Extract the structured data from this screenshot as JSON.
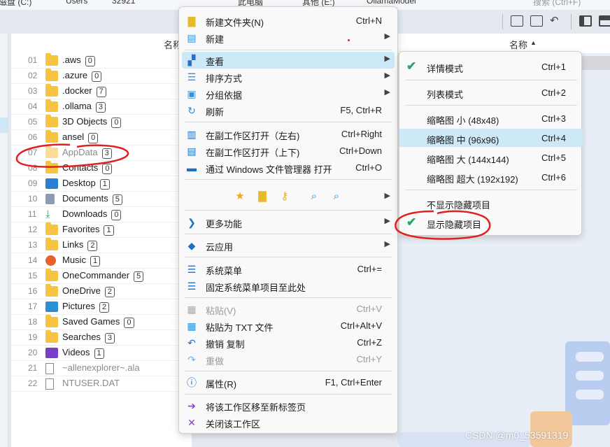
{
  "topbar": {
    "crumb1": "磁盘 (C:)",
    "crumb2": "Users",
    "crumb3": "32921",
    "crumb4": "此电脑",
    "crumb5": "其他 (E:)",
    "crumb6": "OllamaModel",
    "search_placeholder": "搜索 (Ctrl+F)"
  },
  "file_panel": {
    "column_header": "名称",
    "rows": [
      {
        "num": "01",
        "name": ".aws",
        "count": "0",
        "icon": "folder-icon"
      },
      {
        "num": "02",
        "name": ".azure",
        "count": "0",
        "icon": "folder-icon"
      },
      {
        "num": "03",
        "name": ".docker",
        "count": "7",
        "icon": "folder-icon"
      },
      {
        "num": "04",
        "name": ".ollama",
        "count": "3",
        "icon": "folder-icon"
      },
      {
        "num": "05",
        "name": "3D Objects",
        "count": "0",
        "icon": "folder-icon"
      },
      {
        "num": "06",
        "name": "ansel",
        "count": "0",
        "icon": "folder-icon"
      },
      {
        "num": "07",
        "name": "AppData",
        "count": "3",
        "icon": "folder-icon",
        "hidden": true
      },
      {
        "num": "08",
        "name": "Contacts",
        "count": "0",
        "icon": "folder-icon"
      },
      {
        "num": "09",
        "name": "Desktop",
        "count": "1",
        "icon": "desktop-icon"
      },
      {
        "num": "10",
        "name": "Documents",
        "count": "5",
        "icon": "document-icon"
      },
      {
        "num": "11",
        "name": "Downloads",
        "count": "0",
        "icon": "download-icon"
      },
      {
        "num": "12",
        "name": "Favorites",
        "count": "1",
        "icon": "folder-icon"
      },
      {
        "num": "13",
        "name": "Links",
        "count": "2",
        "icon": "folder-icon"
      },
      {
        "num": "14",
        "name": "Music",
        "count": "1",
        "icon": "music-icon"
      },
      {
        "num": "15",
        "name": "OneCommander",
        "count": "5",
        "icon": "folder-icon"
      },
      {
        "num": "16",
        "name": "OneDrive",
        "count": "2",
        "icon": "folder-icon"
      },
      {
        "num": "17",
        "name": "Pictures",
        "count": "2",
        "icon": "pictures-icon"
      },
      {
        "num": "18",
        "name": "Saved Games",
        "count": "0",
        "icon": "folder-icon"
      },
      {
        "num": "19",
        "name": "Searches",
        "count": "3",
        "icon": "folder-icon"
      },
      {
        "num": "20",
        "name": "Videos",
        "count": "1",
        "icon": "video-icon"
      },
      {
        "num": "21",
        "name": "~allenexplorer~.ala",
        "count": "",
        "icon": "file-icon",
        "hidden": true
      },
      {
        "num": "22",
        "name": "NTUSER.DAT",
        "count": "",
        "icon": "file-icon",
        "hidden": true
      }
    ]
  },
  "right_panel": {
    "column_header": "名称"
  },
  "context_menu": {
    "new_folder": {
      "label": "新建文件夹(N)",
      "shortcut": "Ctrl+N"
    },
    "new": {
      "label": "新建"
    },
    "view": {
      "label": "查看"
    },
    "sort_by": {
      "label": "排序方式"
    },
    "group_by": {
      "label": "分组依据"
    },
    "refresh": {
      "label": "刷新",
      "shortcut": "F5, Ctrl+R"
    },
    "open_right": {
      "label": "在副工作区打开（左右)",
      "shortcut": "Ctrl+Right"
    },
    "open_down": {
      "label": "在副工作区打开（上下)",
      "shortcut": "Ctrl+Down"
    },
    "open_windows": {
      "label": "通过 Windows 文件管理器 打开",
      "shortcut": "Ctrl+O"
    },
    "more": {
      "label": "更多功能"
    },
    "cloud": {
      "label": "云应用"
    },
    "system_menu": {
      "label": "系统菜单",
      "shortcut": "Ctrl+="
    },
    "pin_system": {
      "label": "固定系统菜单项目至此处"
    },
    "paste": {
      "label": "粘贴(V)",
      "shortcut": "Ctrl+V"
    },
    "paste_txt": {
      "label": "粘贴为 TXT 文件",
      "shortcut": "Ctrl+Alt+V"
    },
    "undo": {
      "label": "撤销 复制",
      "shortcut": "Ctrl+Z"
    },
    "redo": {
      "label": "重做",
      "shortcut": "Ctrl+Y"
    },
    "properties": {
      "label": "属性(R)",
      "shortcut": "F1, Ctrl+Enter"
    },
    "move_tab": {
      "label": "将该工作区移至新标签页"
    },
    "close_ws": {
      "label": "关闭该工作区"
    }
  },
  "view_submenu": {
    "details": {
      "label": "详情模式",
      "shortcut": "Ctrl+1",
      "checked": true
    },
    "list": {
      "label": "列表模式",
      "shortcut": "Ctrl+2"
    },
    "thumb_small": {
      "label": "缩略图 小 (48x48)",
      "shortcut": "Ctrl+3"
    },
    "thumb_medium": {
      "label": "缩略图 中 (96x96)",
      "shortcut": "Ctrl+4"
    },
    "thumb_large": {
      "label": "缩略图 大 (144x144)",
      "shortcut": "Ctrl+5"
    },
    "thumb_xl": {
      "label": "缩略图 超大 (192x192)",
      "shortcut": "Ctrl+6"
    },
    "hide_hidden": {
      "label": "不显示隐藏项目"
    },
    "show_hidden": {
      "label": "显示隐藏项目",
      "checked": true
    }
  },
  "watermark": "CSDN @m0_53591319",
  "colors": {
    "highlight": "#cde8f7",
    "check": "#2aa66a",
    "annotation": "#e02020",
    "folder": "#f6c441"
  }
}
